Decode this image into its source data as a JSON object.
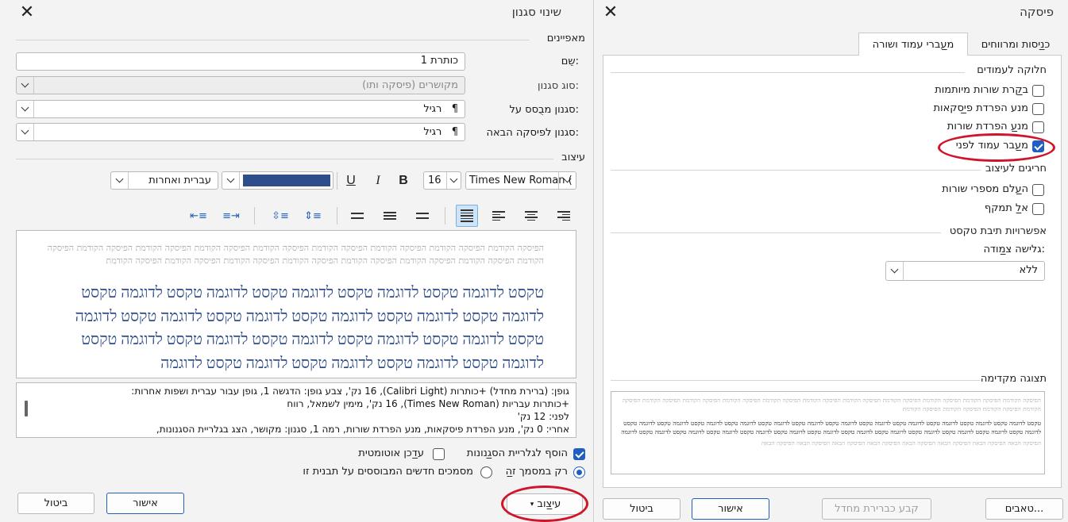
{
  "modify_style": {
    "title": "שינוי סגנון",
    "properties_label": "מאפיינים",
    "name_label": "שֵם:",
    "name_value": "כותרת 1",
    "style_type_label": "סוג סגנון:",
    "style_type_value": "מקושרים (פיסקה ותו)",
    "based_on_label": "סגנון מבֻסס על:",
    "based_on_value": "רגיל",
    "next_style_label": "סגנון לפיסקה הבאה:",
    "next_style_value": "רגיל",
    "pilcrow": "¶",
    "formatting_label": "עיצוב",
    "font_value": "Times New Roman (",
    "size_value": "16",
    "bold": "B",
    "italic": "I",
    "underline": "U",
    "font_color": "#2f4d8a",
    "script_value": "עברית ואחרות",
    "preview_prev_paragraph": "הפיסקה הקודמת הפיסקה הקודמת הפיסקה הקודמת הפיסקה הקודמת הפיסקה הקודמת הפיסקה הקודמת הפיסקה הקודמת הפיסקה הקודמת הפיסקה הקודמת הפיסקה הקודמת הפיסקה הקודמת הפיסקה הקודמת הפיסקה הקודמת הפיסקה הקודמת הפיסקה הקודמת הפיסקה הקודמת",
    "preview_sample_text": "טקסט לדוגמה טקסט לדוגמה טקסט לדוגמה טקסט לדוגמה טקסט לדוגמה טקסט לדוגמה טקסט לדוגמה טקסט לדוגמה טקסט לדוגמה טקסט לדוגמה טקסט לדוגמה טקסט לדוגמה טקסט לדוגמה טקסט לדוגמה טקסט לדוגמה טקסט לדוגמה טקסט לדוגמה טקסט לדוגמה טקסט לדוגמה טקסט לדוגמה טקסט לדוגמה",
    "description_lines": [
      "גופן: (ברירת מחדל) +כותרות (Calibri Light), 16 נק', צבע גופן: הדגשה 1, גופן עבור עברית ושפות אחרות:",
      "+כותרות עבריות (Times New Roman), 16 נק', מימין לשמאל, רווח",
      "לפני:  12  נק'",
      "אחרי:  0  נק', מנע הפרדת פיסקאות, מנע הפרדת שורות, רמה 1, סגנון: מקושר, הצג בגלריית הסגנונות,"
    ],
    "add_to_gallery_label": "הוסף לגלריית הס̲גנונות",
    "auto_update_label": "ע̲דכן אוטומטית",
    "only_this_doc_label": "רק במסמך ז̲ה",
    "new_docs_label": "מסמכים חדשים המבוססים על תבנית זו",
    "format_button": "עי̲צוב",
    "ok_button": "אישור",
    "cancel_button": "ביטול"
  },
  "paragraph": {
    "title": "פיסקה",
    "tab_indents": "כ̲ניסות ומרווחים",
    "tab_breaks": "מ̲עברי עמוד ושורה",
    "pagination_label": "חלוקה לעמודים",
    "widow_control": "ב̲קרת שורות מיותמות",
    "keep_with_next": "מנע הפרדת פ̲יסקאות",
    "keep_lines_together": "מנ̲ע הפרדת שורות",
    "page_break_before": "מ̲עבר עמוד לפני",
    "exceptions_label": "חריגים לעיצוב",
    "suppress_line_numbers": "ה̲עלם מספרי שורות",
    "dont_hyphenate": "א̲ל תמקף",
    "textbox_options_label": "אפשרויות תיבת טקסט",
    "tight_wrap_label": "גלישה צ̲מודה:",
    "tight_wrap_value": "ללא",
    "preview_label": "תצוגה מקדימה",
    "mini_prev": "הפיסקה הקודמת הפיסקה הקודמת הפיסקה הקודמת הפיסקה הקודמת הפיסקה הקודמת הפיסקה הקודמת הפיסקה הקודמת הפיסקה הקודמת הפיסקה הקודמת הפיסקה הקודמת הפיסקה הקודמת הפיסקה הקודמת הפיסקה הקודמת הפיסקה הקודמת",
    "mini_sample": "טקסט לדוגמה טקסט לדוגמה טקסט לדוגמה טקסט לדוגמה טקסט לדוגמה טקסט לדוגמה טקסט לדוגמה טקסט לדוגמה טקסט לדוגמה טקסט לדוגמה טקסט לדוגמה טקסט לדוגמה טקסט לדוגמה טקסט לדוגמה טקסט לדוגמה טקסט לדוגמה טקסט לדוגמה טקסט לדוגמה טקסט לדוגמה טקסט לדוגמה טקסט לדוגמה טקסט לדוגמה טקסט לדוגמה טקסט לדוגמה טקסט לדוגמה",
    "mini_next": "הפיסקה הבאה הפיסקה הבאה הפיסקה הבאה הפיסקה הבאה הפיסקה הבאה הפיסקה הבאה הפיסקה הבאה הפיסקה הבאה",
    "tabs_button": "טאבים...",
    "set_default_button": "קבע כברירת מחדל",
    "ok_button": "אישור",
    "cancel_button": "ביטול"
  },
  "highlight_color": "#d0142a"
}
